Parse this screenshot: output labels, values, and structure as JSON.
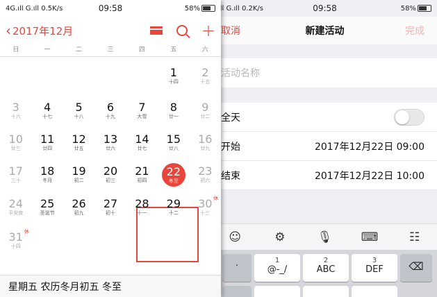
{
  "calendar": {
    "status": {
      "left": "4G.ıll G.ıll 0.5K/s",
      "time": "09:58",
      "right": "58%"
    },
    "back_label": "2017年12月",
    "weekdays": [
      "日",
      "一",
      "二",
      "三",
      "四",
      "五",
      "六"
    ],
    "days": [
      {
        "d": "1",
        "lu": "十四",
        "wk": false
      },
      {
        "d": "2",
        "lu": "十五",
        "wk": true
      },
      {
        "d": "3",
        "lu": "十六",
        "wk": true
      },
      {
        "d": "4",
        "lu": "十七",
        "wk": false
      },
      {
        "d": "5",
        "lu": "十八",
        "wk": false
      },
      {
        "d": "6",
        "lu": "十九",
        "wk": false
      },
      {
        "d": "7",
        "lu": "大雪",
        "wk": false
      },
      {
        "d": "8",
        "lu": "廿一",
        "wk": false
      },
      {
        "d": "9",
        "lu": "廿二",
        "wk": true
      },
      {
        "d": "10",
        "lu": "廿三",
        "wk": true
      },
      {
        "d": "11",
        "lu": "廿四",
        "wk": false
      },
      {
        "d": "12",
        "lu": "廿五",
        "wk": false
      },
      {
        "d": "13",
        "lu": "廿六",
        "wk": false
      },
      {
        "d": "14",
        "lu": "廿七",
        "wk": false
      },
      {
        "d": "15",
        "lu": "廿八",
        "wk": false
      },
      {
        "d": "16",
        "lu": "廿九",
        "wk": true
      },
      {
        "d": "17",
        "lu": "三十",
        "wk": true
      },
      {
        "d": "18",
        "lu": "冬月",
        "wk": false
      },
      {
        "d": "19",
        "lu": "初二",
        "wk": false
      },
      {
        "d": "20",
        "lu": "初三",
        "wk": false
      },
      {
        "d": "21",
        "lu": "初四",
        "wk": false
      },
      {
        "d": "22",
        "lu": "冬至",
        "wk": false,
        "today": true
      },
      {
        "d": "23",
        "lu": "初六",
        "wk": true
      },
      {
        "d": "24",
        "lu": "平安夜",
        "wk": true
      },
      {
        "d": "25",
        "lu": "圣诞节",
        "wk": false
      },
      {
        "d": "26",
        "lu": "初九",
        "wk": false
      },
      {
        "d": "27",
        "lu": "初十",
        "wk": false
      },
      {
        "d": "28",
        "lu": "十一",
        "wk": false
      },
      {
        "d": "29",
        "lu": "十二",
        "wk": false
      },
      {
        "d": "30",
        "lu": "十三",
        "wk": true,
        "rest": "休"
      },
      {
        "d": "31",
        "lu": "十四",
        "wk": true,
        "rest": "休"
      }
    ],
    "footer": "星期五  农历冬月初五  冬至"
  },
  "event": {
    "status": {
      "left": "ıll G.ıll 0.2K/s",
      "time": "09:58",
      "right": "58%"
    },
    "cancel": "取消",
    "title": "新建活动",
    "done": "完成",
    "name_placeholder": "活动名称",
    "allday_label": "全天",
    "start_label": "开始",
    "start_value": "2017年12月22日 09:00",
    "end_label": "结束",
    "end_value": "2017年12月22日 10:00"
  },
  "keyboard": {
    "keys": [
      {
        "n": "1",
        "t": "@-_/"
      },
      {
        "n": "2",
        "t": "ABC"
      },
      {
        "n": "3",
        "t": "DEF"
      }
    ],
    "dot": "·"
  },
  "colors": {
    "accent": "#e8453c"
  }
}
